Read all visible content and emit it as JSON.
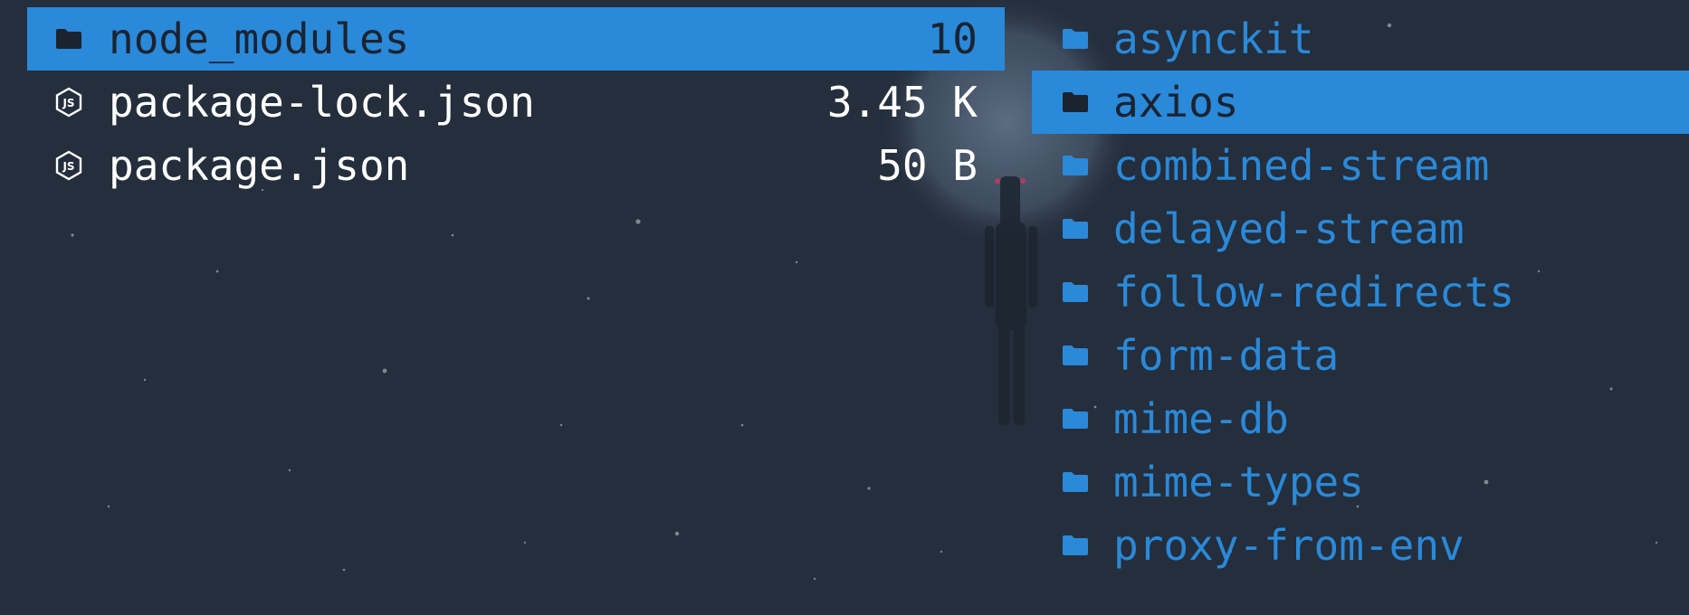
{
  "colors": {
    "background": "#242e3c",
    "selection": "#2a89d9",
    "directory_text": "#2a89d9",
    "file_text": "#ffffff",
    "selected_text": "#1b2331"
  },
  "left_pane": {
    "items": [
      {
        "name": "node_modules",
        "size": "10",
        "icon": "folder-icon",
        "selected": true
      },
      {
        "name": "package-lock.json",
        "size": "3.45 K",
        "icon": "nodejs-icon",
        "selected": false
      },
      {
        "name": "package.json",
        "size": "50 B",
        "icon": "nodejs-icon",
        "selected": false
      }
    ]
  },
  "right_pane": {
    "items": [
      {
        "name": "asynckit",
        "icon": "folder-icon",
        "selected": false
      },
      {
        "name": "axios",
        "icon": "folder-icon",
        "selected": true
      },
      {
        "name": "combined-stream",
        "icon": "folder-icon",
        "selected": false
      },
      {
        "name": "delayed-stream",
        "icon": "folder-icon",
        "selected": false
      },
      {
        "name": "follow-redirects",
        "icon": "folder-icon",
        "selected": false
      },
      {
        "name": "form-data",
        "icon": "folder-icon",
        "selected": false
      },
      {
        "name": "mime-db",
        "icon": "folder-icon",
        "selected": false
      },
      {
        "name": "mime-types",
        "icon": "folder-icon",
        "selected": false
      },
      {
        "name": "proxy-from-env",
        "icon": "folder-icon",
        "selected": false
      }
    ]
  }
}
